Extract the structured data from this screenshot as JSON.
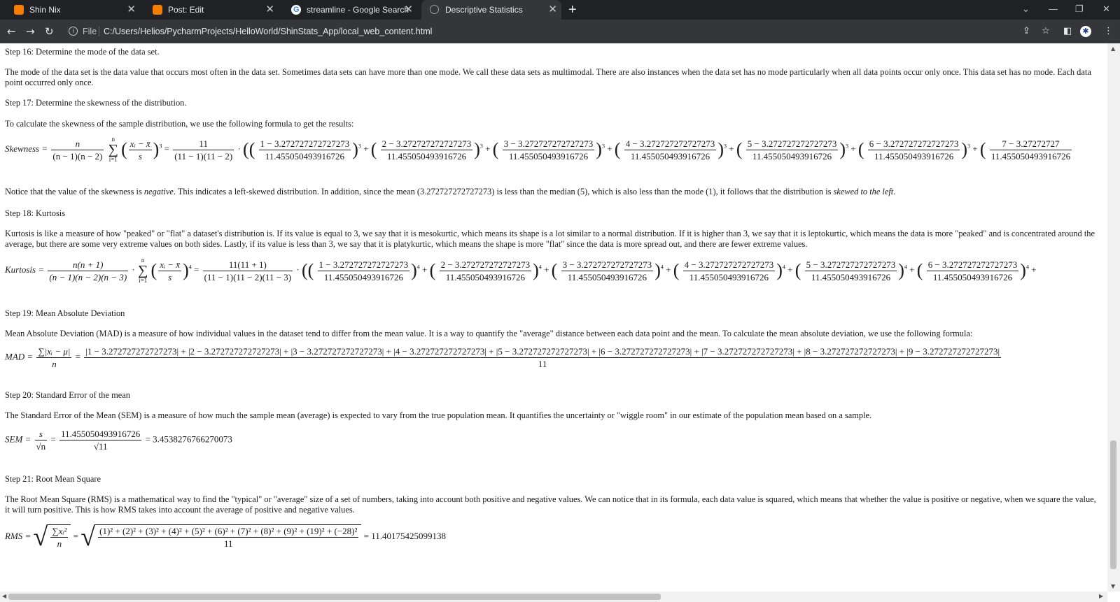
{
  "browser": {
    "tabs": [
      {
        "title": "Shin Nix",
        "favicon": "blogger-icon"
      },
      {
        "title": "Post: Edit",
        "favicon": "blogger-icon"
      },
      {
        "title": "streamline - Google Search",
        "favicon": "google-icon"
      },
      {
        "title": "Descriptive Statistics",
        "favicon": "globe-icon",
        "active": true
      }
    ],
    "new_tab": "+",
    "file_label": "File",
    "url": "C:/Users/Helios/PycharmProjects/HelloWorld/ShinStats_App/local_web_content.html"
  },
  "content": {
    "step16_heading": "Step 16: Determine the mode of the data set.",
    "step16_text": "The mode of the data set is the data value that occurs most often in the data set. Sometimes data sets can have more than one mode. We call these data sets as multimodal. There are also instances when the data set has no mode particularly when all data points occur only once. This data set has no mode. Each data point occurred only once.",
    "step17_heading": "Step 17: Determine the skewness of the distribution.",
    "step17_text": "To calculate the skewness of the sample distribution, we use the following formula to get the results:",
    "skew_label": "Skewness =",
    "skew_formula_n": "n",
    "skew_formula_d": "(n − 1)(n − 2)",
    "skew_frac_n": "11",
    "skew_frac_d": "(11 − 1)(11 − 2)",
    "skew_terms": [
      "1 − 3.272727272727273",
      "2 − 3.272727272727273",
      "3 − 3.272727272727273",
      "4 − 3.272727272727273",
      "5 − 3.272727272727273",
      "6 − 3.272727272727273",
      "7 − 3.27272727"
    ],
    "sd_value": "11.455050493916726",
    "skew_note_a": "Notice that the value of the skewness is",
    "skew_note_neg": "negative",
    "skew_note_b": ". This indicates a left-skewed distribution. In addition, since the mean (3.272727272727273) is less than the median (5), which is also less than the mode (1), it follows that the distribution is",
    "skew_note_left": "skewed to the left",
    "step18_heading": "Step 18: Kurtosis",
    "step18_text": "Kurtosis is like a measure of how \"peaked\" or \"flat\" a dataset's distribution is. If its value is equal to 3, we say that it is mesokurtic, which means its shape is a lot similar to a normal distribution. If it is higher than 3, we say that it is leptokurtic, which means the data is more \"peaked\" and is concentrated around the average, but there are some very extreme values on both sides. Lastly, if its value is less than 3, we say that it is platykurtic, which means the shape is more \"flat\" since the data is more spread out, and there are fewer extreme values.",
    "kurt_label": "Kurtosis =",
    "kurt_formula_n": "n(n + 1)",
    "kurt_formula_d": "(n − 1)(n − 2)(n − 3)",
    "kurt_frac_n": "11(11 + 1)",
    "kurt_frac_d": "(11 − 1)(11 − 2)(11 − 3)",
    "kurt_terms": [
      "1 − 3.272727272727273",
      "2 − 3.272727272727273",
      "3 − 3.272727272727273",
      "4 − 3.272727272727273",
      "5 − 3.272727272727273",
      "6 − 3.272727272727273"
    ],
    "step19_heading": "Step 19: Mean Absolute Deviation",
    "step19_text": "Mean Absolute Deviation (MAD) is a measure of how individual values in the dataset tend to differ from the mean value. It is a way to quantify the \"average\" distance between each data point and the mean. To calculate the mean absolute deviation, we use the following formula:",
    "mad_label": "MAD =",
    "mad_formula_n": "∑|xᵢ − μ|",
    "mad_formula_d": "n",
    "mad_numerator": "|1 − 3.272727272727273| + |2 − 3.272727272727273| + |3 − 3.272727272727273| + |4 − 3.272727272727273| + |5 − 3.272727272727273| + |6 − 3.272727272727273| + |7 − 3.272727272727273| + |8 − 3.272727272727273| + |9 − 3.272727272727273|",
    "mad_denominator": "11",
    "step20_heading": "Step 20: Standard Error of the mean",
    "step20_text": "The Standard Error of the Mean (SEM) is a measure of how much the sample mean (average) is expected to vary from the true population mean. It quantifies the uncertainty or \"wiggle room\" in our estimate of the population mean based on a sample.",
    "sem_label": "SEM =",
    "sem_formula_n": "s",
    "sem_formula_d": "√n",
    "sem_frac_n": "11.455050493916726",
    "sem_frac_d": "√11",
    "sem_result": "= 3.4538276766270073",
    "step21_heading": "Step 21: Root Mean Square",
    "step21_text": "The Root Mean Square (RMS) is a mathematical way to find the \"typical\" or \"average\" size of a set of numbers, taking into account both positive and negative values. We can notice that in its formula, each data value is squared, which means that whether the value is positive or negative, when we square the value, it will turn positive. This is how RMS takes into account the average of positive and negative values.",
    "rms_label": "RMS =",
    "rms_formula_n": "∑xᵢ²",
    "rms_formula_d": "n",
    "rms_numerator": "(1)² + (2)² + (3)² + (4)² + (5)² + (6)² + (7)² + (8)² + (9)² + (19)² + (−28)²",
    "rms_denominator": "11",
    "rms_result": "= 11.40175425099138"
  }
}
